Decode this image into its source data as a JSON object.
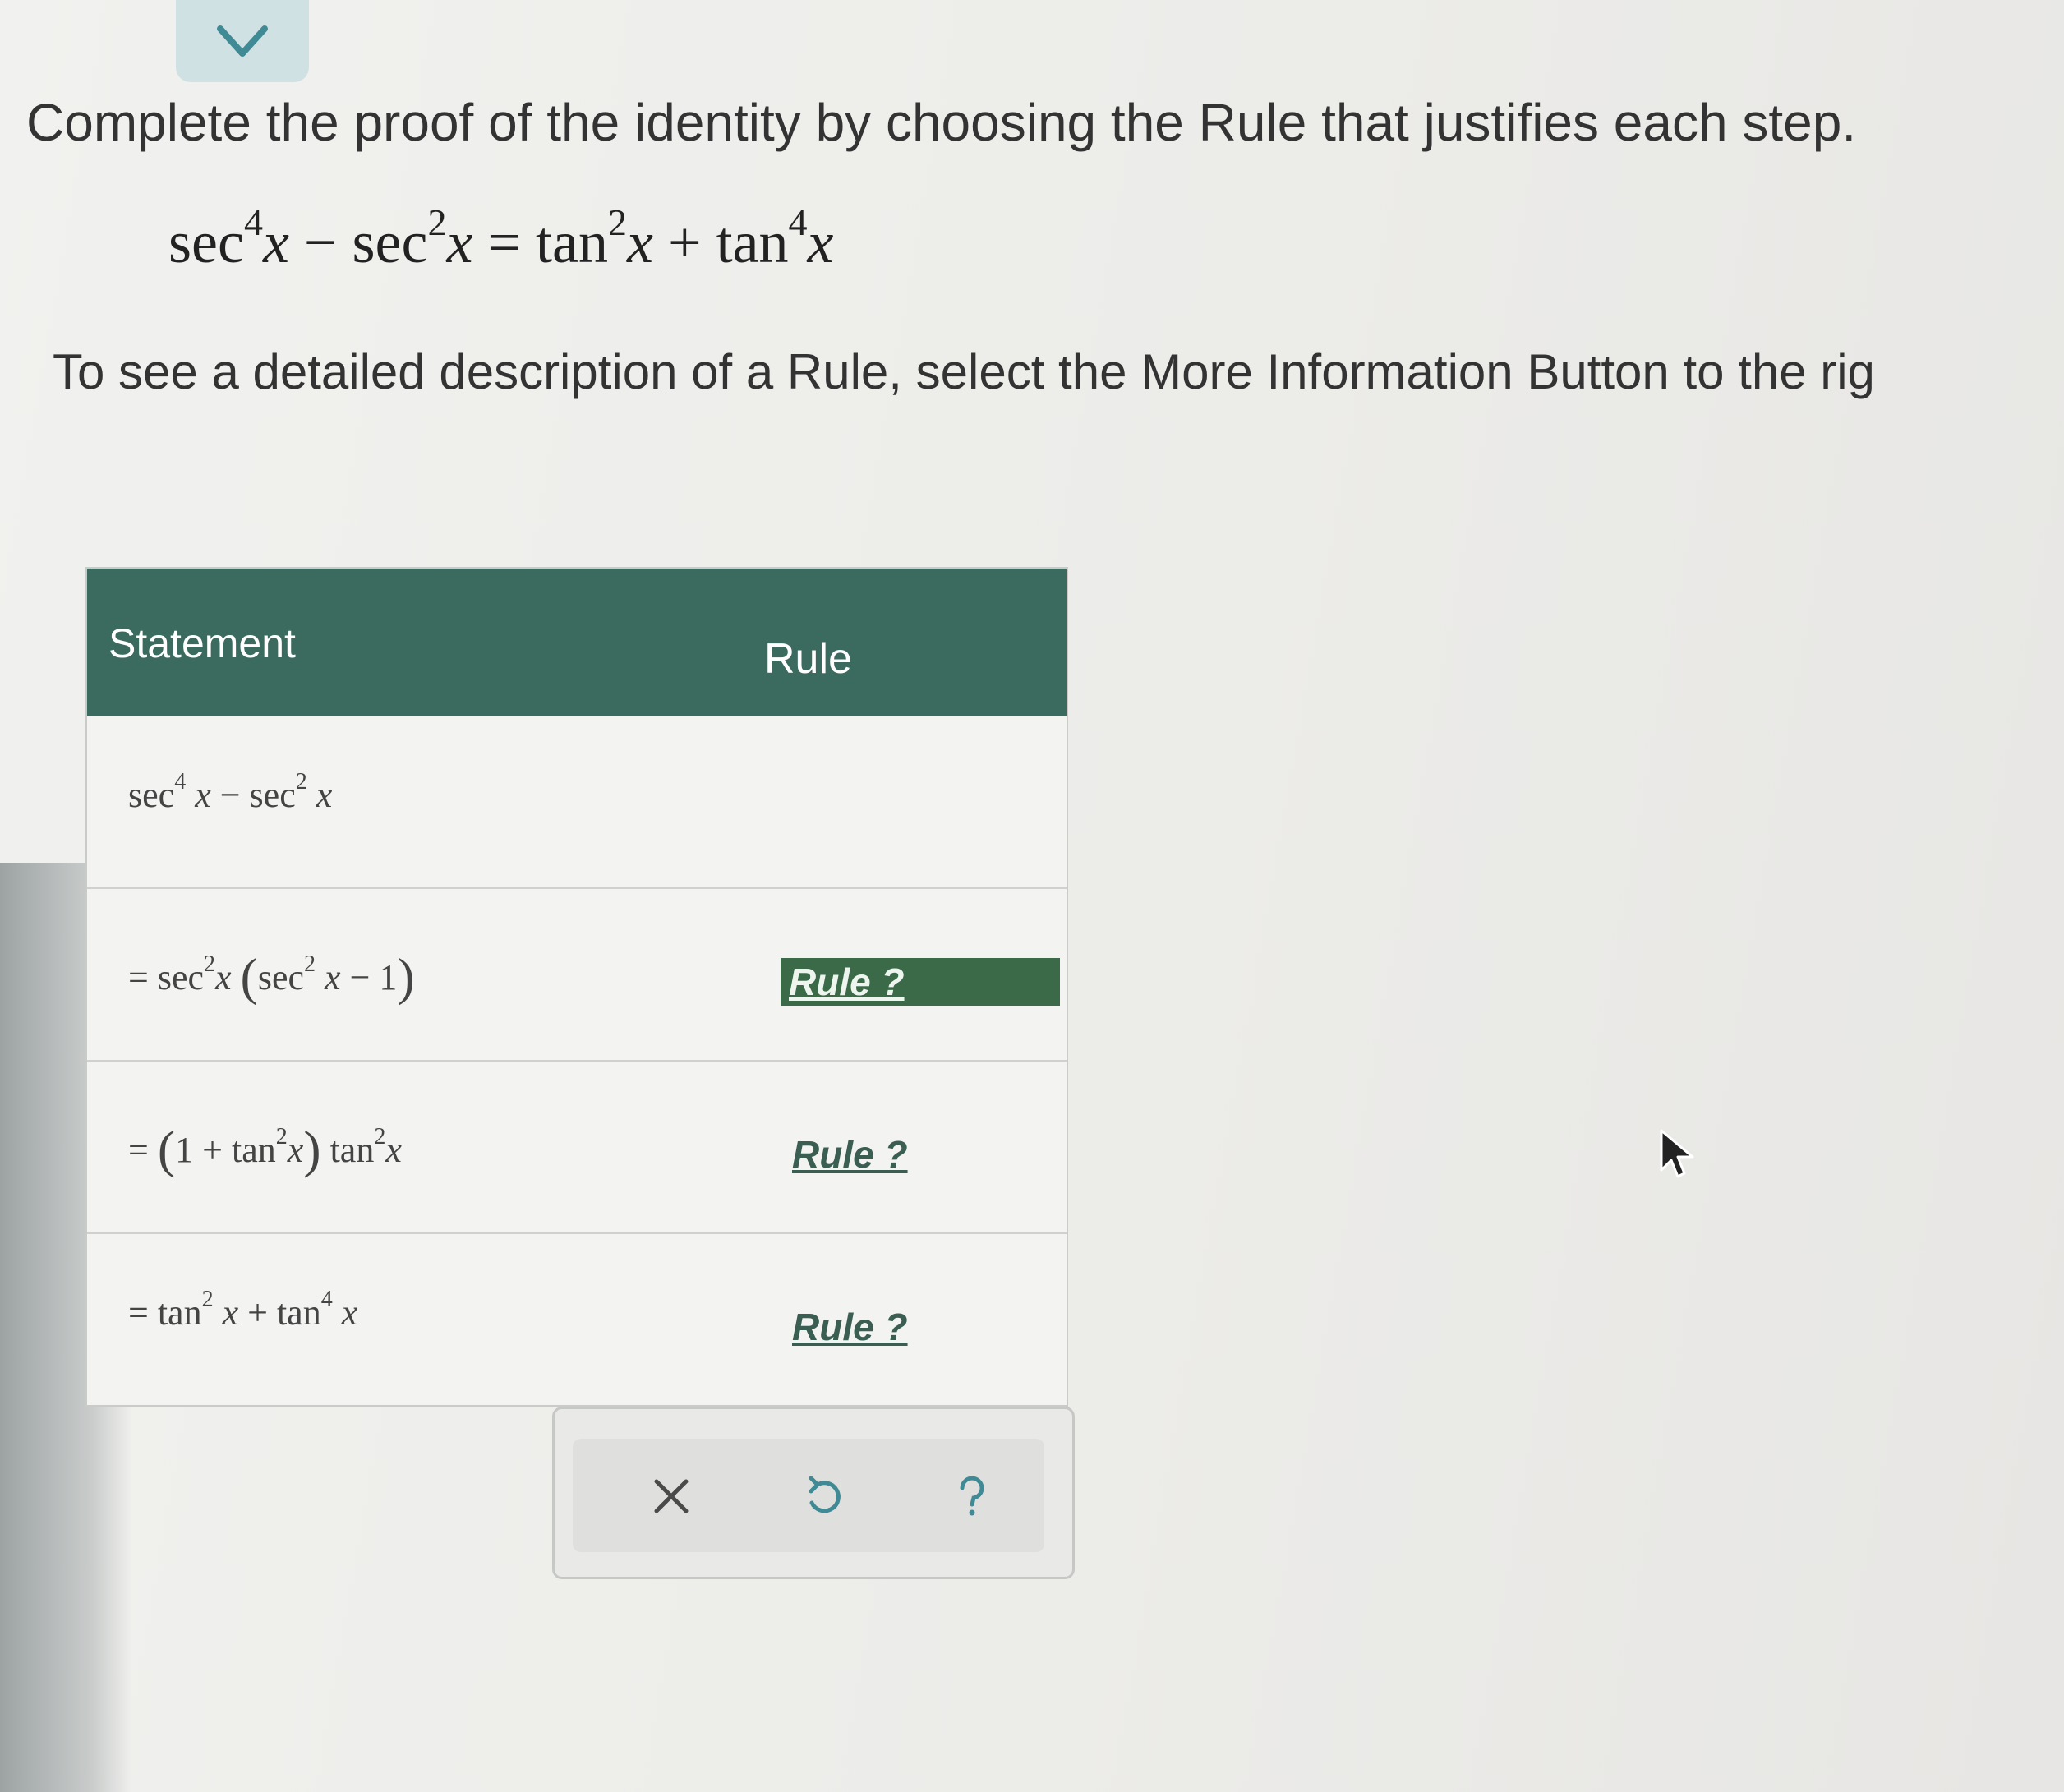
{
  "instruction": "Complete the proof of the identity by choosing the Rule that justifies each step.",
  "identity": {
    "lhs1_fn": "sec",
    "lhs1_exp": "4",
    "var": "x",
    "minus": "−",
    "lhs2_fn": "sec",
    "lhs2_exp": "2",
    "equals": "=",
    "rhs1_fn": "tan",
    "rhs1_exp": "2",
    "plus": "+",
    "rhs2_fn": "tan",
    "rhs2_exp": "4"
  },
  "info_text": "To see a detailed description of a Rule, select the More Information Button to the rig",
  "table": {
    "header_statement": "Statement",
    "header_rule": "Rule",
    "rows": [
      {
        "eq": "",
        "t1": "sec",
        "e1": "4",
        "v": "x",
        "op": "−",
        "t2": "sec",
        "e2": "2",
        "rule": ""
      },
      {
        "eq": "=",
        "t1": "sec",
        "e1": "2",
        "v": "x",
        "lp": "(",
        "t2": "sec",
        "e2": "2",
        "op": "−",
        "one": "1",
        "rp": ")",
        "rule": "Rule ?"
      },
      {
        "eq": "=",
        "lp": "(",
        "one": "1",
        "op": "+",
        "t1": "tan",
        "e1": "2",
        "v": "x",
        "rp": ")",
        "t2": "tan",
        "e2": "2",
        "rule": "Rule ?"
      },
      {
        "eq": "=",
        "t1": "tan",
        "e1": "2",
        "v": "x",
        "op": "+",
        "t2": "tan",
        "e2": "4",
        "rule": "Rule ?"
      }
    ]
  },
  "toolbar": {
    "clear_icon": "close-icon",
    "undo_icon": "undo-icon",
    "help_icon": "help-icon"
  },
  "colors": {
    "header_bg": "#3b6a5e",
    "selected_rule_bg": "#3b6a48",
    "collapse_tab_bg": "#cfe1e3",
    "icon_teal": "#3f8a95"
  }
}
